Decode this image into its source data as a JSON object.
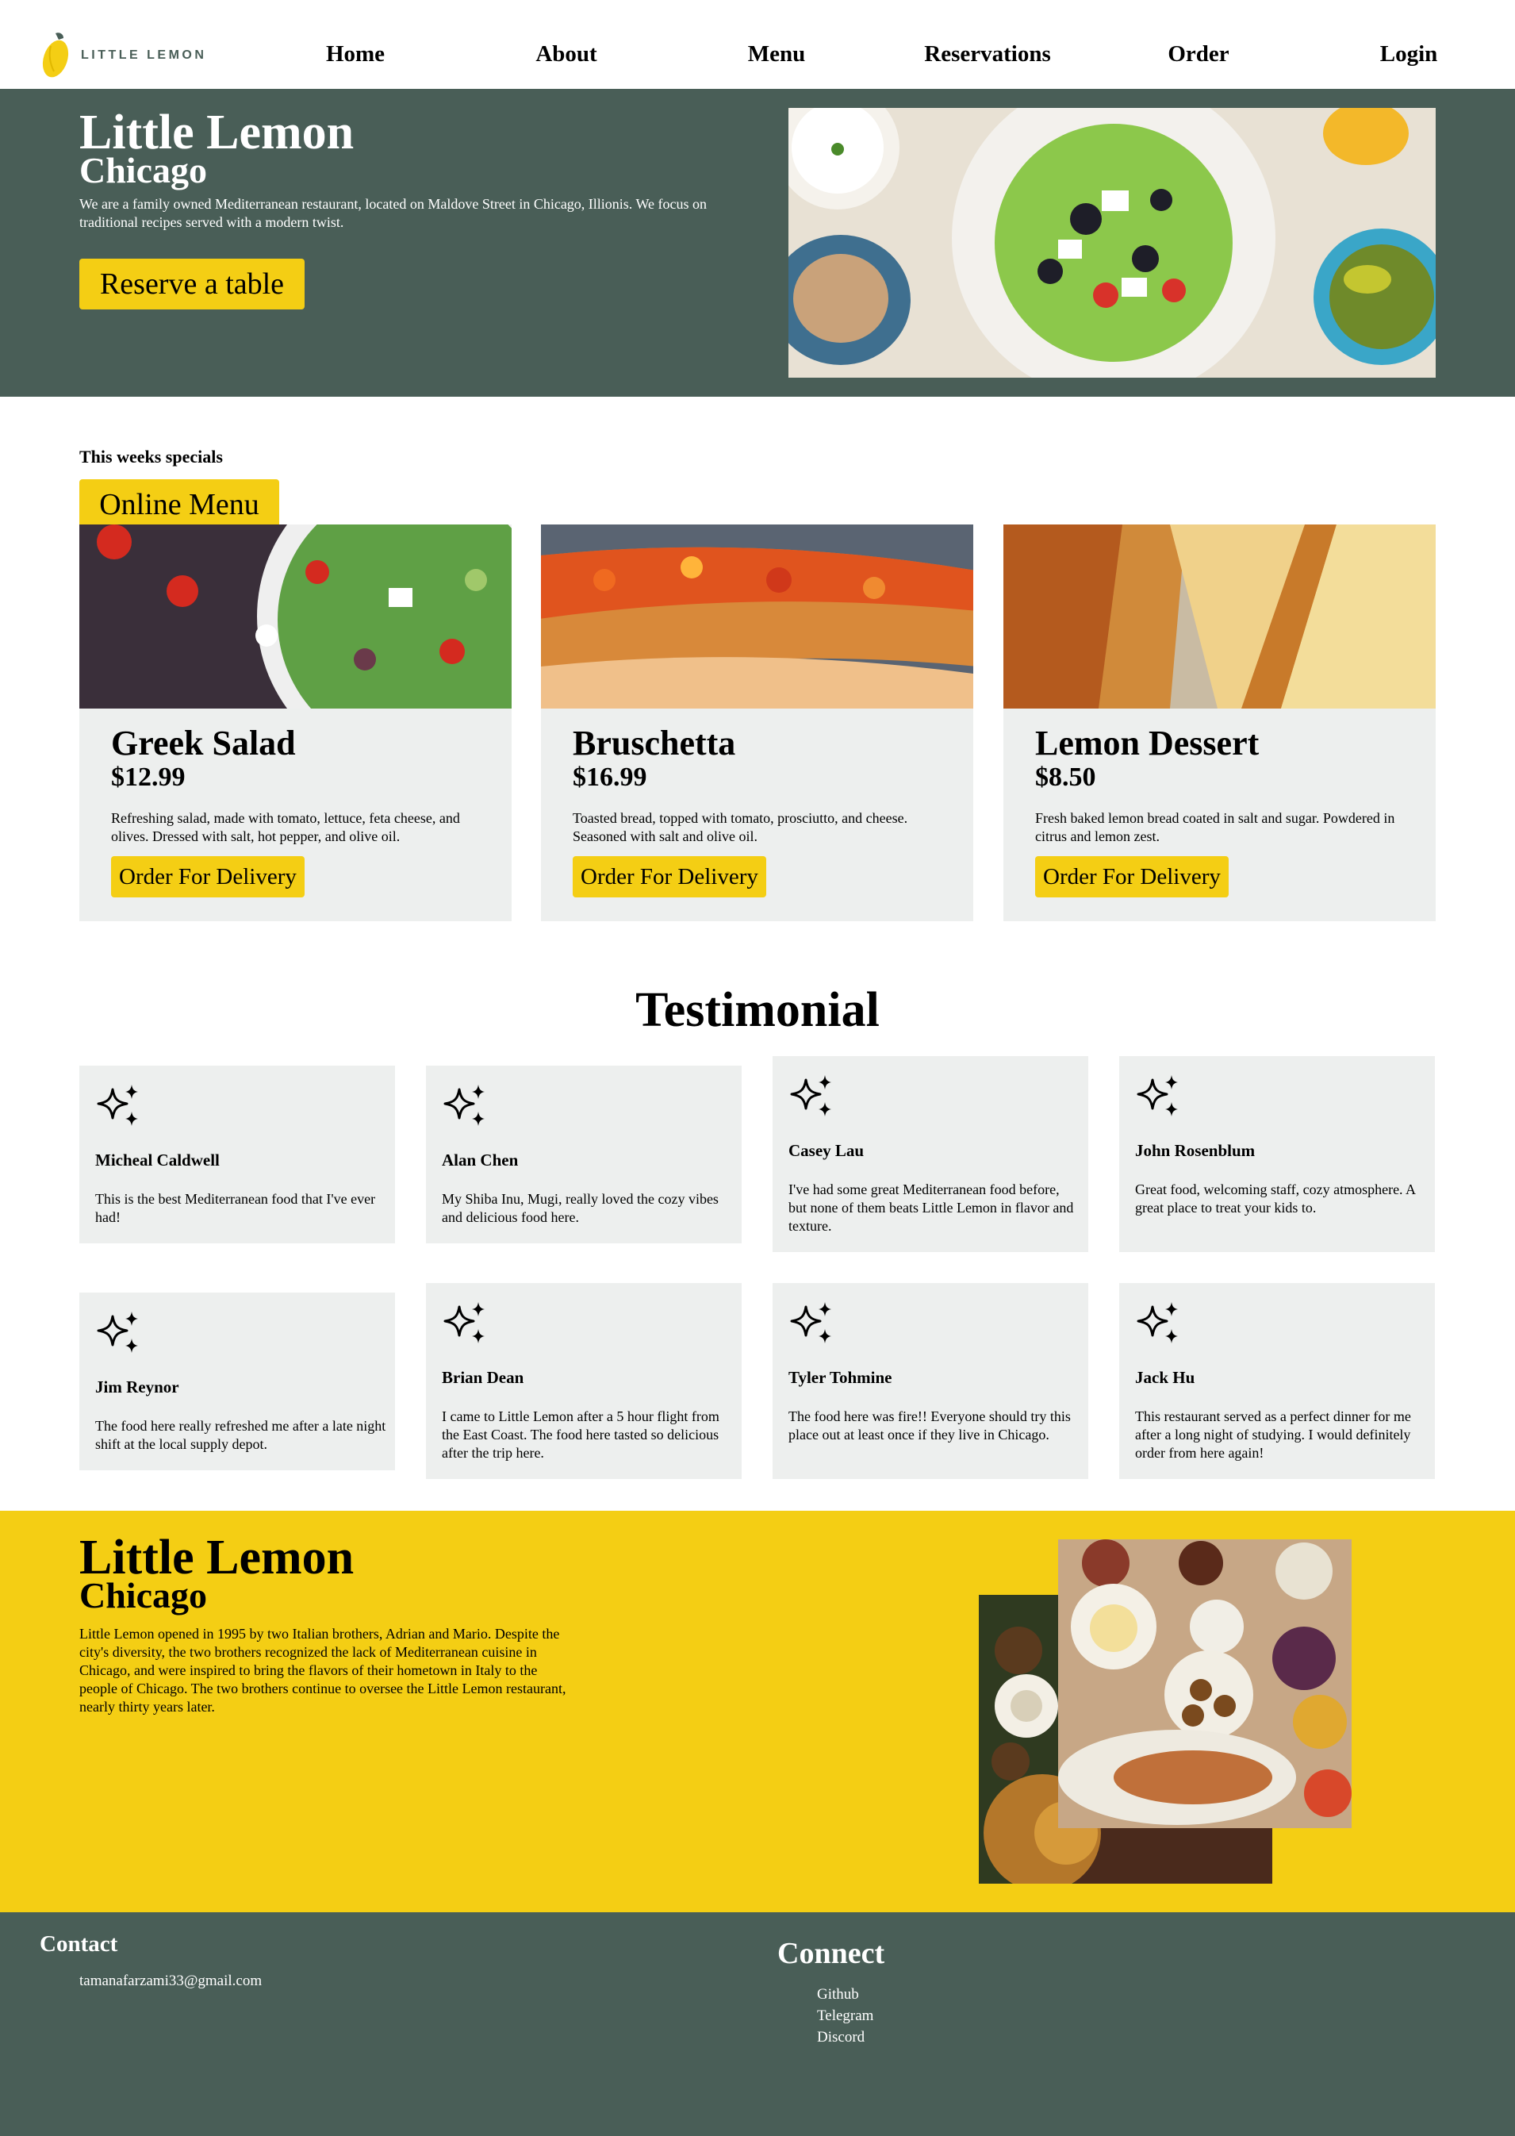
{
  "header": {
    "logo_text": "LITTLE LEMON",
    "nav": [
      {
        "label": "Home"
      },
      {
        "label": "About"
      },
      {
        "label": "Menu"
      },
      {
        "label": "Reservations"
      },
      {
        "label": "Order"
      },
      {
        "label": "Login"
      }
    ]
  },
  "hero": {
    "title": "Little Lemon",
    "subtitle": "Chicago",
    "description": "We are a family owned Mediterranean restaurant, located on Maldove Street in Chicago, Illionis. We focus on traditional recipes served with a modern twist.",
    "button_label": "Reserve a table"
  },
  "specials": {
    "label": "This weeks specials",
    "online_menu_label": "Online Menu",
    "cards": [
      {
        "title": "Greek Salad",
        "price": "$12.99",
        "description": "Refreshing salad, made with tomato, lettuce, feta cheese, and olives. Dressed with salt, hot pepper, and olive oil.",
        "button_label": "Order For Delivery"
      },
      {
        "title": "Bruschetta",
        "price": "$16.99",
        "description": "Toasted bread, topped with tomato, prosciutto, and cheese. Seasoned with salt and olive oil.",
        "button_label": "Order For Delivery"
      },
      {
        "title": "Lemon Dessert",
        "price": "$8.50",
        "description": "Fresh baked lemon bread coated in salt and sugar. Powdered in citrus and lemon zest.",
        "button_label": "Order For Delivery"
      }
    ]
  },
  "testimonials": {
    "title": "Testimonial",
    "items": [
      {
        "name": "Micheal Caldwell",
        "text": "This is the best Mediterranean food that I've ever had!"
      },
      {
        "name": "Alan Chen",
        "text": "My Shiba Inu, Mugi, really loved the cozy vibes and delicious food here."
      },
      {
        "name": "Casey Lau",
        "text": "I've had some great Mediterranean food before, but none of them beats Little Lemon in flavor and texture."
      },
      {
        "name": "John Rosenblum",
        "text": "Great food, welcoming staff, cozy atmosphere. A great place to treat your kids to."
      },
      {
        "name": "Jim Reynor",
        "text": "The food here really refreshed me after a late night shift at the local supply depot."
      },
      {
        "name": "Brian Dean",
        "text": "I came to Little Lemon after a 5 hour flight from the East Coast. The food here tasted so delicious after the trip here."
      },
      {
        "name": "Tyler Tohmine",
        "text": "The food here was fire!! Everyone should try this place out at least once if they live in Chicago."
      },
      {
        "name": "Jack Hu",
        "text": "This restaurant served as a perfect dinner for me after a long night of studying. I would definitely order from here again!"
      }
    ]
  },
  "about": {
    "title": "Little Lemon",
    "subtitle": "Chicago",
    "description": "Little Lemon opened in 1995 by two Italian brothers, Adrian and Mario. Despite the city's diversity, the two brothers recognized the lack of Mediterranean cuisine in Chicago, and were inspired to bring the flavors of their hometown in Italy to the people of Chicago. The two brothers continue to oversee the Little Lemon restaurant, nearly thirty years later."
  },
  "footer": {
    "contact_heading": "Contact",
    "email": "tamanafarzami33@gmail.com",
    "connect_heading": "Connect",
    "links": [
      "Github",
      "Telegram",
      "Discord"
    ]
  },
  "colors": {
    "primary_green": "#495e57",
    "primary_yellow": "#f4ce14",
    "card_gray": "#edefee"
  },
  "icons": [
    "lemon-logo-icon",
    "sparkle-icon"
  ]
}
